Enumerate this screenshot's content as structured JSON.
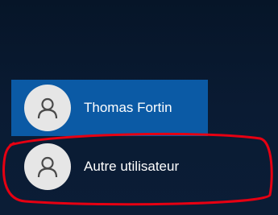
{
  "users": [
    {
      "name": "Thomas Fortin",
      "avatar_icon": "user-silhouette-icon",
      "selected": true
    },
    {
      "name": "Autre utilisateur",
      "avatar_icon": "user-silhouette-icon",
      "selected": false
    }
  ],
  "colors": {
    "background": "#0a1b33",
    "selected_tile": "#0b5aa5",
    "avatar_bg": "#e6e6e6",
    "avatar_icon": "#4a4a4a",
    "highlight_annotation": "#e60012"
  }
}
